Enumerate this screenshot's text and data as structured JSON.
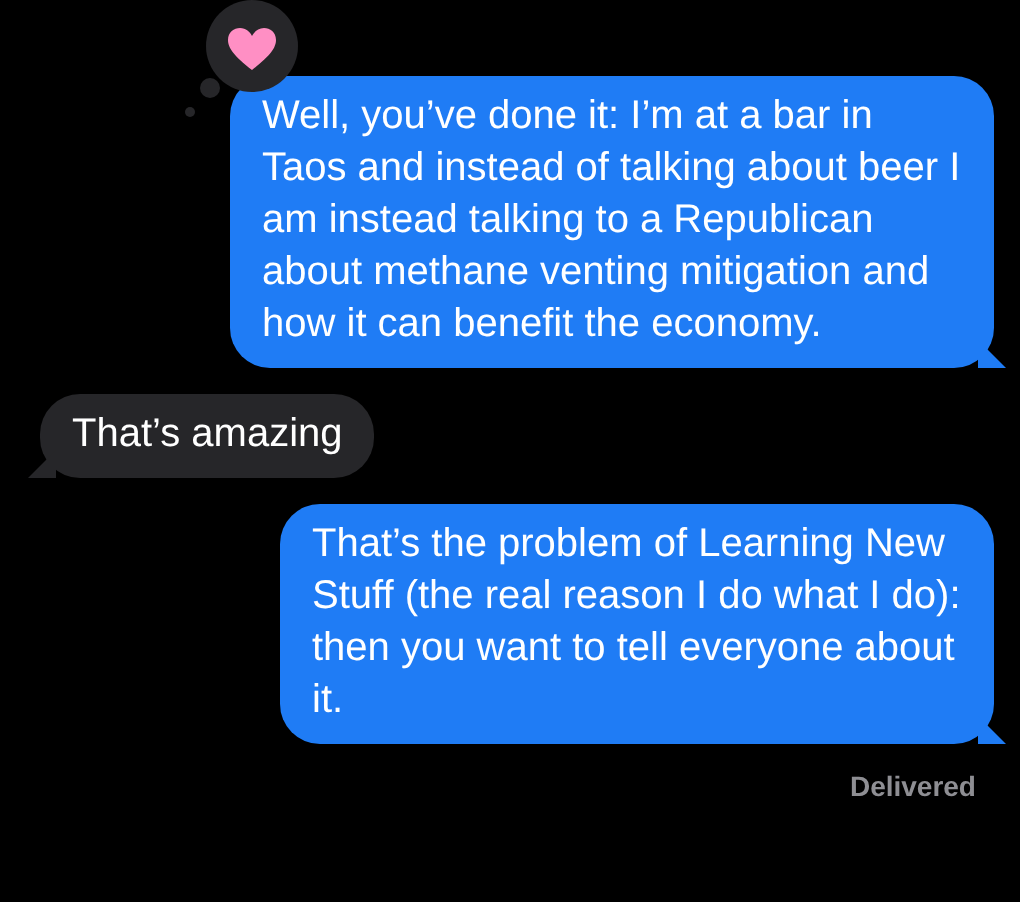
{
  "messages": [
    {
      "kind": "sent",
      "text": "Well, you’ve done it: I’m at a bar in Taos and instead of talking about beer I am instead talking to a Republican about methane venting mitigation and how it can benefit the economy.",
      "hearted": true
    },
    {
      "kind": "received",
      "text": "That’s amazing"
    },
    {
      "kind": "sent",
      "text": "That’s the problem of Learning New Stuff (the real reason I do what I do): then you want to tell everyone about it."
    }
  ],
  "status": "Delivered"
}
